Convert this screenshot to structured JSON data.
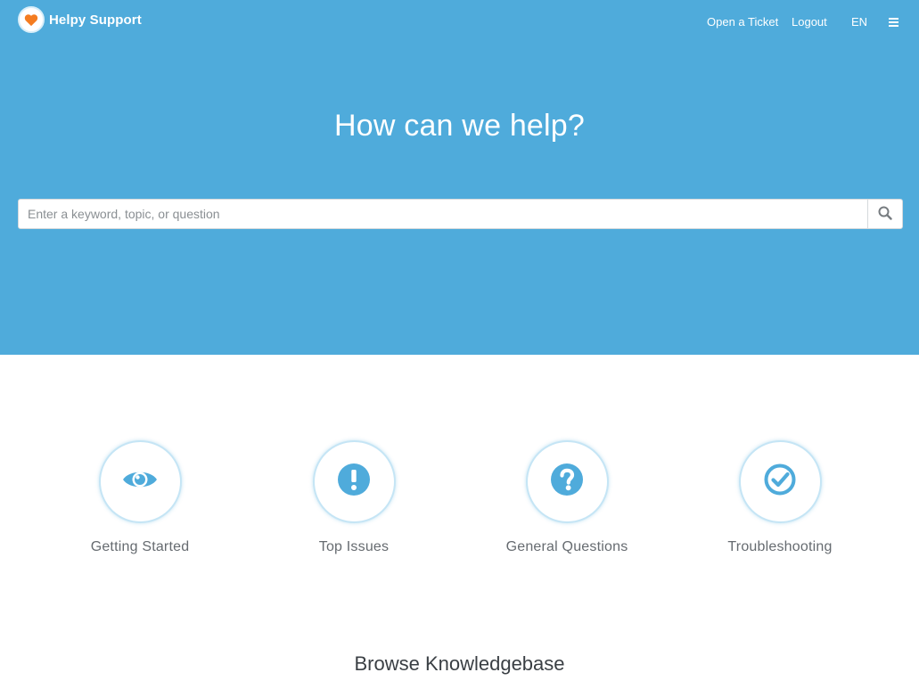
{
  "header": {
    "brand_name": "Helpy Support",
    "nav": {
      "open_ticket": "Open a Ticket",
      "logout": "Logout",
      "language": "EN"
    }
  },
  "hero": {
    "title": "How can we help?",
    "search": {
      "placeholder": "Enter a keyword, topic, or question",
      "value": ""
    }
  },
  "categories": [
    {
      "label": "Getting Started",
      "icon": "eye-icon"
    },
    {
      "label": "Top Issues",
      "icon": "exclamation-icon"
    },
    {
      "label": "General Questions",
      "icon": "question-icon"
    },
    {
      "label": "Troubleshooting",
      "icon": "check-circle-icon"
    }
  ],
  "knowledgebase": {
    "title": "Browse Knowledgebase"
  },
  "colors": {
    "hero_bg": "#4fabdb",
    "accent": "#4fabdb",
    "logo_heart": "#f47c20"
  }
}
